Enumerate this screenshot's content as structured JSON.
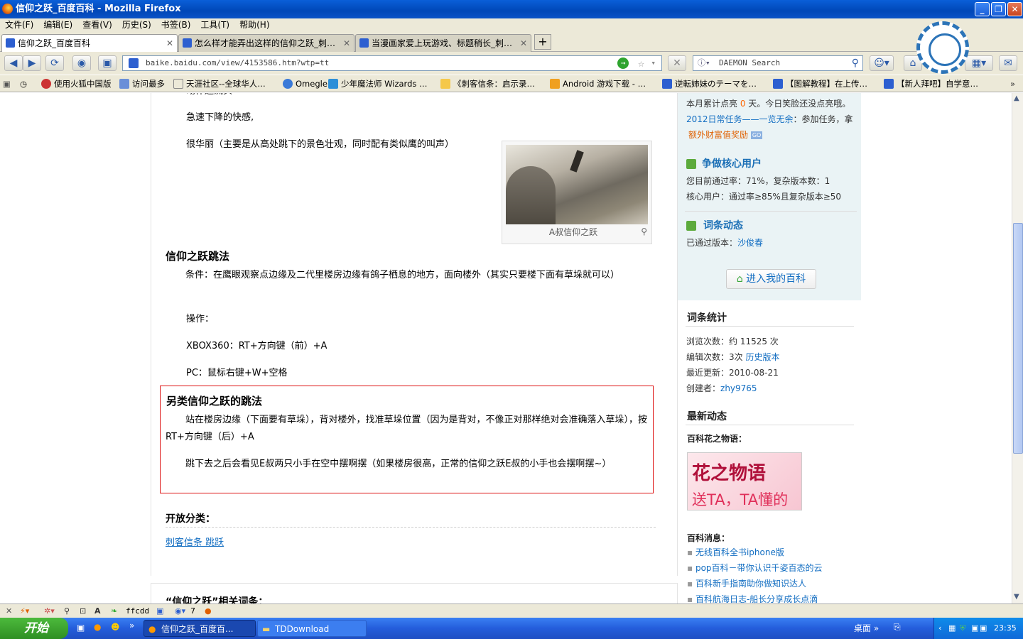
{
  "window": {
    "title": "信仰之跃_百度百科 - Mozilla Firefox"
  },
  "menu": [
    "文件(F)",
    "编辑(E)",
    "查看(V)",
    "历史(S)",
    "书签(B)",
    "工具(T)",
    "帮助(H)"
  ],
  "tabs": [
    {
      "label": "信仰之跃_百度百科"
    },
    {
      "label": "怎么样才能弄出这样的信仰之跃_刺…"
    },
    {
      "label": "当漫画家爱上玩游戏、标题稍长_刺…"
    }
  ],
  "nav": {
    "url": "baike.baidu.com/view/4153586.htm?wtp=tt",
    "search_placeholder": "DAEMON Search"
  },
  "bookmarks": [
    "使用火狐中国版",
    "访问最多",
    "天涯社区--全球华人…",
    "Omegle",
    "少年魔法师 Wizards …",
    "《刺客信条：启示录…",
    "Android 游戏下载 - …",
    "逆転姉妹のテーマを…",
    "【图解教程】在上传…",
    "【新人拜吧】自学意…"
  ],
  "article": {
    "p_cut": "动作还流头",
    "p1": "急速下降的快感,",
    "p2": "很华丽（主要是从高处跳下的景色壮观，同时配有类似鹰的叫声）",
    "figure_caption": "A叔信仰之跃",
    "h_jump": "信仰之跃跳法",
    "cond": "条件：在鹰眼观察点边缘及二代里楼房边缘有鸽子栖息的地方，面向楼外（其实只要楼下面有草垛就可以）",
    "op": "操作：",
    "xbox": "XBOX360：RT+方向键（前）+A",
    "pc": "PC：鼠标右键+W+空格",
    "h_alt": "另类信仰之跃的跳法",
    "alt1": "站在楼房边缘（下面要有草垛），背对楼外，找准草垛位置（因为是背对，不像正对那样绝对会准确落入草垛），按RT+方向键（后）+A",
    "alt2": "跳下去之后会看见E叔两只小手在空中摆啊摆（如果楼房很高，正常的信仰之跃E叔的小手也会摆啊摆~）",
    "open_cat": "开放分类：",
    "cat_link": "刺客信条 跳跃",
    "related": "“信仰之跃”相关词条："
  },
  "sidebar": {
    "month_a": "本月累计点亮 ",
    "month_num": "0",
    "month_b": " 天。今日笑脸还没点亮哦。",
    "task_link": "2012日常任务——一览无余",
    "task_text": "：参加任务，拿",
    "bonus": "额外财富值奖励",
    "go": "GO",
    "core_title": "争做核心用户",
    "core1": "您目前通过率：71%，复杂版本数：1",
    "core2": "核心用户：通过率≥85%且复杂版本≥50",
    "dyn_title": "词条动态",
    "passed_label": "已通过版本：",
    "passed_user": "沙俊春",
    "enter_btn": "进入我的百科",
    "stats_title": "词条统计",
    "views": "浏览次数：约 11525 次",
    "edits_label": "编辑次数：3次 ",
    "history_link": "历史版本",
    "updated": "最近更新：2010-08-21",
    "creator_label": "创建者：",
    "creator": "zhy9765",
    "news_title": "最新动态",
    "flower_title": "百科花之物语：",
    "flower_t1": "花之物语",
    "flower_t2": "送TA，TA懂的",
    "msg_title": "百科消息：",
    "msgs": [
      "无线百科全书iphone版",
      "pop百科－带你认识千姿百态的云",
      "百科新手指南助你做知识达人",
      "百科航海日志-船长分享成长点滴"
    ]
  },
  "statusbar": {
    "text1": "ffcdd",
    "count": "7"
  },
  "taskbar": {
    "start": "开始",
    "tasks": [
      "信仰之跃_百度百...",
      "TDDownload"
    ],
    "desktop": "桌面",
    "clock": "23:35"
  }
}
